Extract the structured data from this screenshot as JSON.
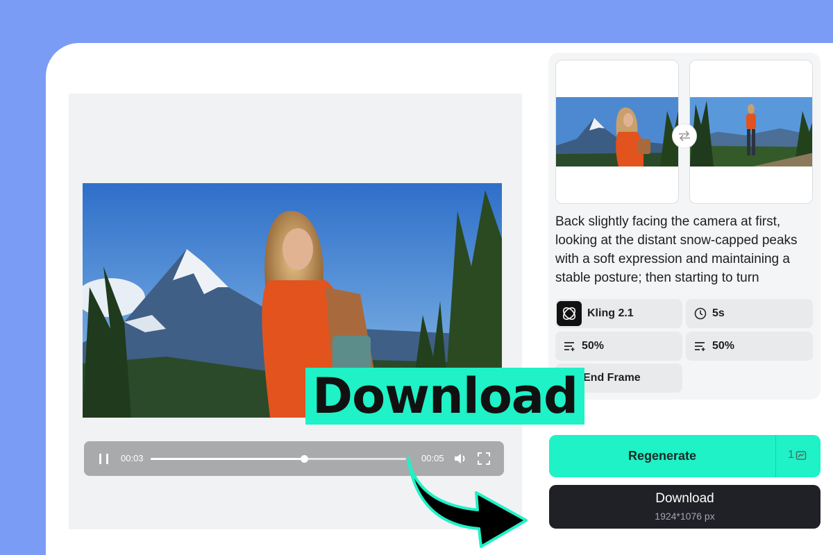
{
  "player": {
    "current_time": "00:03",
    "total_time": "00:05",
    "progress_fraction": 0.6
  },
  "prompt": "Back slightly facing the camera at first, looking at the distant snow-capped peaks with a soft expression and maintaining a stable posture; then starting to turn",
  "settings": {
    "model": "Kling 2.1",
    "duration": "5s",
    "motion_1": "50%",
    "motion_2": "50%",
    "end_frame": "End Frame"
  },
  "actions": {
    "regenerate": "Regenerate",
    "credits": "1",
    "download": "Download",
    "resolution": "1924*1076 px"
  },
  "promo": "Download",
  "colors": {
    "background": "#7b9cf5",
    "accent": "#1ef2c6",
    "dark_button": "#1f2126"
  },
  "icons": [
    "pause-icon",
    "volume-icon",
    "fullscreen-icon",
    "swap-icon",
    "model-logo-icon",
    "clock-icon",
    "motion-icon",
    "end-frame-icon",
    "credits-icon",
    "arrow-icon"
  ]
}
